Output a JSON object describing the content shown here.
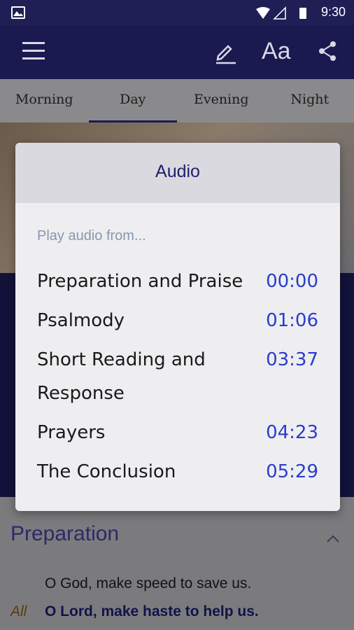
{
  "status": {
    "time": "9:30"
  },
  "tabs": [
    "Morning",
    "Day",
    "Evening",
    "Night"
  ],
  "appbar": {
    "font_label": "Aa"
  },
  "dialog": {
    "title": "Audio",
    "subtitle": "Play audio from...",
    "items": [
      {
        "name": "Preparation and Praise",
        "time": "00:00"
      },
      {
        "name": "Psalmody",
        "time": "01:06"
      },
      {
        "name": "Short Reading and Response",
        "time": "03:37"
      },
      {
        "name": "Prayers",
        "time": "04:23"
      },
      {
        "name": "The Conclusion",
        "time": "05:29"
      }
    ]
  },
  "content": {
    "heading": "Preparation",
    "line1": "O God, make speed to save us.",
    "speaker": "All",
    "line2": "O Lord, make haste to help us."
  },
  "colors": {
    "appbar": "#1a1a50",
    "accent": "#2b3ccf",
    "dialog_title": "#1f1f6e"
  }
}
